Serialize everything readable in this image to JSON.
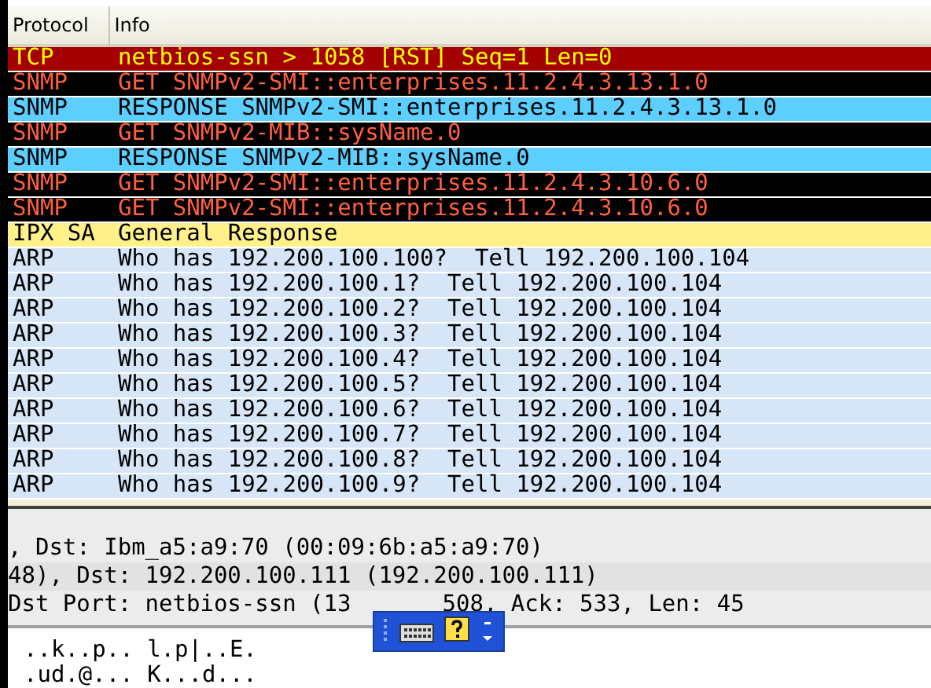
{
  "packet_list": {
    "columns": [
      "Protocol",
      "Info"
    ],
    "rows": [
      {
        "kind": "tcp",
        "protocol": "TCP",
        "info": "netbios-ssn > 1058 [RST] Seq=1 Len=0"
      },
      {
        "kind": "snmp-get",
        "protocol": "SNMP",
        "info": "GET SNMPv2-SMI::enterprises.11.2.4.3.13.1.0"
      },
      {
        "kind": "snmp-response",
        "protocol": "SNMP",
        "info": "RESPONSE SNMPv2-SMI::enterprises.11.2.4.3.13.1.0"
      },
      {
        "kind": "snmp-get",
        "protocol": "SNMP",
        "info": "GET SNMPv2-MIB::sysName.0"
      },
      {
        "kind": "snmp-response",
        "protocol": "SNMP",
        "info": "RESPONSE SNMPv2-MIB::sysName.0"
      },
      {
        "kind": "snmp-get",
        "protocol": "SNMP",
        "info": "GET SNMPv2-SMI::enterprises.11.2.4.3.10.6.0"
      },
      {
        "kind": "snmp-get",
        "protocol": "SNMP",
        "info": "GET SNMPv2-SMI::enterprises.11.2.4.3.10.6.0"
      },
      {
        "kind": "ipx",
        "protocol": "IPX SA",
        "info": "General Response"
      },
      {
        "kind": "arp",
        "protocol": "ARP",
        "info": "Who has 192.200.100.100?  Tell 192.200.100.104"
      },
      {
        "kind": "arp",
        "protocol": "ARP",
        "info": "Who has 192.200.100.1?  Tell 192.200.100.104"
      },
      {
        "kind": "arp",
        "protocol": "ARP",
        "info": "Who has 192.200.100.2?  Tell 192.200.100.104"
      },
      {
        "kind": "arp",
        "protocol": "ARP",
        "info": "Who has 192.200.100.3?  Tell 192.200.100.104"
      },
      {
        "kind": "arp",
        "protocol": "ARP",
        "info": "Who has 192.200.100.4?  Tell 192.200.100.104"
      },
      {
        "kind": "arp",
        "protocol": "ARP",
        "info": "Who has 192.200.100.5?  Tell 192.200.100.104"
      },
      {
        "kind": "arp",
        "protocol": "ARP",
        "info": "Who has 192.200.100.6?  Tell 192.200.100.104"
      },
      {
        "kind": "arp",
        "protocol": "ARP",
        "info": "Who has 192.200.100.7?  Tell 192.200.100.104"
      },
      {
        "kind": "arp",
        "protocol": "ARP",
        "info": "Who has 192.200.100.8?  Tell 192.200.100.104"
      },
      {
        "kind": "arp",
        "protocol": "ARP",
        "info": "Who has 192.200.100.9?  Tell 192.200.100.104"
      }
    ]
  },
  "details": [
    {
      "parts": [
        ", Dst: Ibm_a5:a9:70 (00:09:6b:a5:a9:70)"
      ]
    },
    {
      "parts": [
        "48), Dst: 192.200.100.111 (192.200.100.111)"
      ]
    },
    {
      "parts": [
        "Dst Port: netbios-ssn (13",
        "508, Ack: 533, Len: 45"
      ]
    }
  ],
  "bytes": [
    "..k..p.. l.p|..E.",
    ".ud.@... K...d..."
  ]
}
